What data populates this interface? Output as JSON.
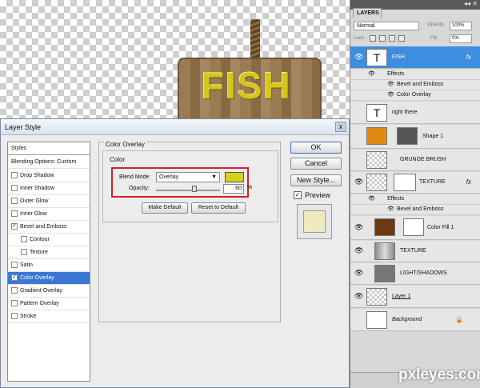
{
  "canvas": {
    "sign_text": "FISH"
  },
  "dialog": {
    "title": "Layer Style",
    "close": "x",
    "styles": [
      {
        "label": "Styles",
        "checkbox": false,
        "checked": false
      },
      {
        "label": "Blending Options: Custom",
        "checkbox": false,
        "checked": false
      },
      {
        "label": "Drop Shadow",
        "checkbox": true,
        "checked": false
      },
      {
        "label": "Inner Shadow",
        "checkbox": true,
        "checked": false
      },
      {
        "label": "Outer Glow",
        "checkbox": true,
        "checked": false
      },
      {
        "label": "Inner Glow",
        "checkbox": true,
        "checked": false
      },
      {
        "label": "Bevel and Emboss",
        "checkbox": true,
        "checked": true
      },
      {
        "label": "Contour",
        "checkbox": true,
        "checked": false
      },
      {
        "label": "Texture",
        "checkbox": true,
        "checked": false
      },
      {
        "label": "Satin",
        "checkbox": true,
        "checked": false
      },
      {
        "label": "Color Overlay",
        "checkbox": true,
        "checked": true
      },
      {
        "label": "Gradient Overlay",
        "checkbox": true,
        "checked": false
      },
      {
        "label": "Pattern Overlay",
        "checkbox": true,
        "checked": false
      },
      {
        "label": "Stroke",
        "checkbox": true,
        "checked": false
      }
    ],
    "section_title": "Color Overlay",
    "group_title": "Color",
    "blend_mode_label": "Blend Mode:",
    "blend_mode_value": "Overlay",
    "overlay_color": "#d6d11a",
    "opacity_label": "Opacity:",
    "opacity_value": "60",
    "opacity_unit": "%",
    "opacity_fraction": 0.6,
    "make_default": "Make Default",
    "reset_default": "Reset to Default",
    "ok": "OK",
    "cancel": "Cancel",
    "new_style": "New Style...",
    "preview_label": "Preview",
    "preview_checked": true,
    "check_mark": "✓",
    "selected_style_color": "#3b78d6"
  },
  "layers_panel": {
    "tab": "LAYERS",
    "header_controls": "◂◂ ✕",
    "blend_mode": "Normal",
    "opacity_label": "Opacity:",
    "opacity_value": "100%",
    "lock_label": "Lock:",
    "fill_label": "Fill:",
    "fill_value": "0%",
    "fx_symbol": "fx",
    "effects_label": "Effects",
    "eye_symbol": "👁",
    "text_thumb": "T",
    "layers": [
      {
        "name": "FISH",
        "selected": true,
        "effects": [
          "Bevel and Emboss",
          "Color Overlay"
        ]
      },
      {
        "name": "right there"
      },
      {
        "name": "Shape 1"
      },
      {
        "name": "GRUNGE BRUSH"
      },
      {
        "name": "TEXTURE",
        "effects": [
          "Bevel and Emboss"
        ]
      },
      {
        "name": "Color Fill 1"
      },
      {
        "name": "TEXTURE"
      },
      {
        "name": "LIGHT/SHADOWS"
      },
      {
        "name": "Layer 1"
      },
      {
        "name": "Background"
      }
    ],
    "selected_color": "#3e8ee0"
  },
  "watermark": "pxleyes.com"
}
